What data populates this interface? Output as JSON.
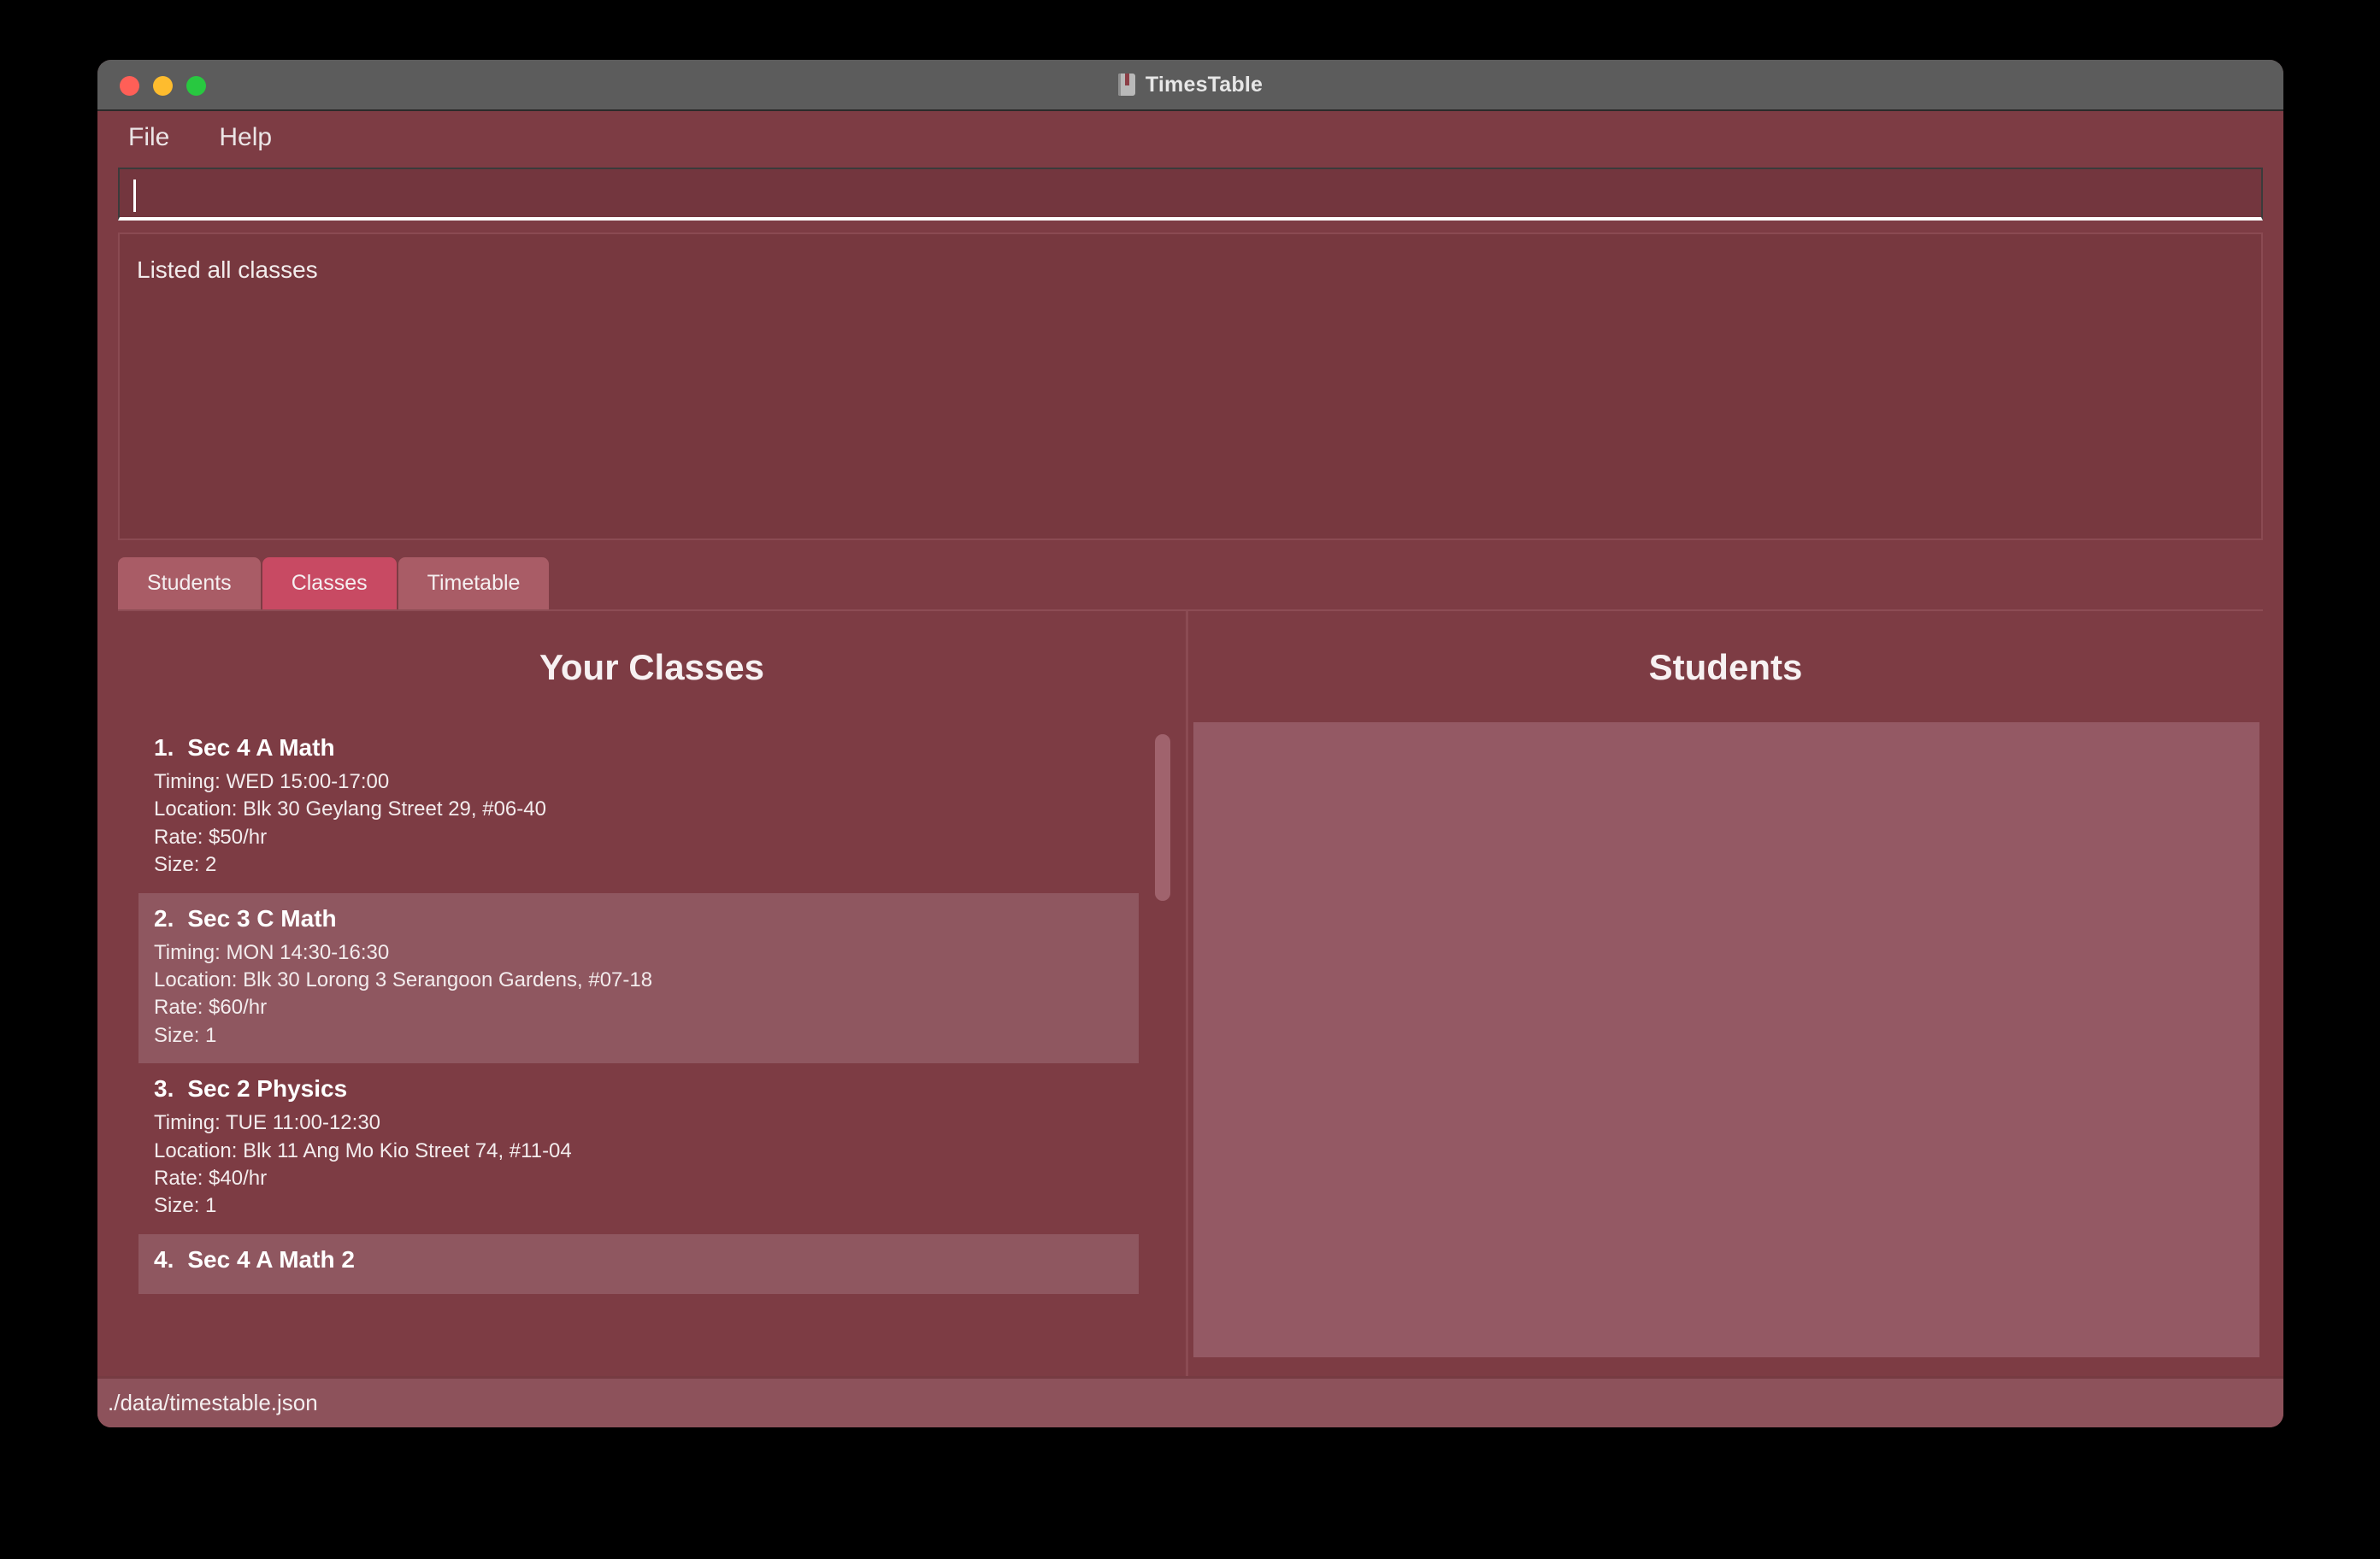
{
  "window": {
    "title": "TimesTable",
    "icon": "book-icon",
    "traffic_lights": [
      "close",
      "minimize",
      "maximize"
    ]
  },
  "menu": {
    "items": [
      {
        "label": "File"
      },
      {
        "label": "Help"
      }
    ]
  },
  "command": {
    "value": "",
    "placeholder": ""
  },
  "result": {
    "text": "Listed all classes"
  },
  "tabs": [
    {
      "label": "Students",
      "active": false
    },
    {
      "label": "Classes",
      "active": true
    },
    {
      "label": "Timetable",
      "active": false
    }
  ],
  "classes_panel": {
    "title": "Your Classes",
    "items": [
      {
        "index": "1.",
        "name": "Sec 4 A Math",
        "timing": "Timing: WED 15:00-17:00",
        "location": "Location: Blk 30 Geylang Street 29, #06-40",
        "rate": "Rate: $50/hr",
        "size": "Size: 2"
      },
      {
        "index": "2.",
        "name": "Sec 3 C Math",
        "timing": "Timing: MON 14:30-16:30",
        "location": "Location: Blk 30 Lorong 3 Serangoon Gardens, #07-18",
        "rate": "Rate: $60/hr",
        "size": "Size: 1"
      },
      {
        "index": "3.",
        "name": "Sec 2 Physics",
        "timing": "Timing: TUE 11:00-12:30",
        "location": "Location: Blk 11 Ang Mo Kio Street 74, #11-04",
        "rate": "Rate: $40/hr",
        "size": "Size: 1"
      },
      {
        "index": "4.",
        "name": "Sec 4 A Math 2",
        "timing": "",
        "location": "",
        "rate": "",
        "size": ""
      }
    ]
  },
  "students_panel": {
    "title": "Students",
    "items": []
  },
  "status": {
    "text": "./data/timestable.json"
  },
  "colors": {
    "window_bg": "#7d3c44",
    "title_bar": "#5c5c5c",
    "accent_tab_active": "#c84a63",
    "tab_inactive": "#a95c66",
    "row_alt": "#8f5760",
    "status_bar": "#8d525b",
    "text": "#f3eced"
  }
}
